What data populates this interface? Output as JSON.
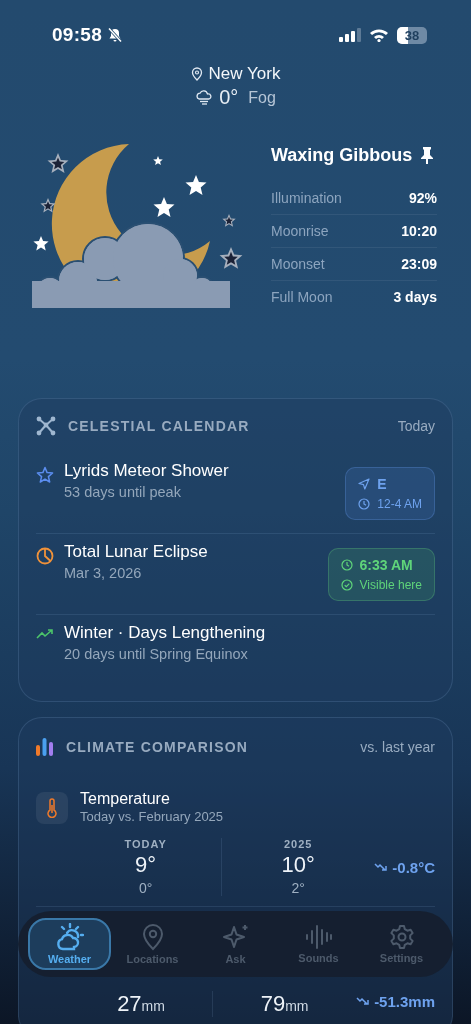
{
  "status_bar": {
    "time": "09:58",
    "battery": "38"
  },
  "location": {
    "name": "New York",
    "temperature": "0°",
    "condition": "Fog"
  },
  "moon": {
    "phase": "Waxing Gibbous",
    "pinned": true,
    "stats": [
      {
        "label": "Illumination",
        "value": "92%"
      },
      {
        "label": "Moonrise",
        "value": "10:20"
      },
      {
        "label": "Moonset",
        "value": "23:09"
      },
      {
        "label": "Full Moon",
        "value": "3 days"
      }
    ]
  },
  "celestial_calendar": {
    "title": "CELESTIAL CALENDAR",
    "trailing": "Today",
    "events": [
      {
        "kind": "meteor",
        "color": "#5b8def",
        "title": "Lyrids Meteor Shower",
        "subtitle": "53 days until peak",
        "badge": [
          {
            "kind": "direction",
            "text": "E"
          },
          {
            "kind": "time",
            "text": "12-4 AM"
          }
        ]
      },
      {
        "kind": "eclipse",
        "color": "#f0923a",
        "title": "Total Lunar Eclipse",
        "subtitle": "Mar 3, 2026",
        "badge": [
          {
            "kind": "time",
            "text": "6:33 AM"
          },
          {
            "kind": "visible",
            "text": "Visible here"
          }
        ]
      },
      {
        "kind": "trend",
        "color": "#4cc46a",
        "title": "Winter · Days Lengthening",
        "subtitle": "20 days until Spring Equinox"
      }
    ]
  },
  "climate_comparison": {
    "title": "CLIMATE COMPARISON",
    "trailing": "vs. last year",
    "metrics": [
      {
        "kind": "temperature",
        "title": "Temperature",
        "subtitle": "Today vs. February 2025",
        "columns": [
          {
            "label": "TODAY",
            "value": "9°",
            "sub": "0°"
          },
          {
            "label": "2025",
            "value": "10°",
            "sub": "2°"
          }
        ],
        "delta": "-0.8°C"
      },
      {
        "kind": "precipitation",
        "columns": [
          {
            "value": "27",
            "unit": "mm"
          },
          {
            "value": "79",
            "unit": "mm"
          }
        ],
        "delta": "-51.3mm"
      }
    ]
  },
  "nav": {
    "items": [
      {
        "kind": "weather",
        "label": "Weather",
        "selected": true
      },
      {
        "kind": "locations",
        "label": "Locations",
        "selected": false
      },
      {
        "kind": "ask",
        "label": "Ask",
        "selected": false
      },
      {
        "kind": "sounds",
        "label": "Sounds",
        "selected": false
      },
      {
        "kind": "settings",
        "label": "Settings",
        "selected": false
      }
    ]
  }
}
